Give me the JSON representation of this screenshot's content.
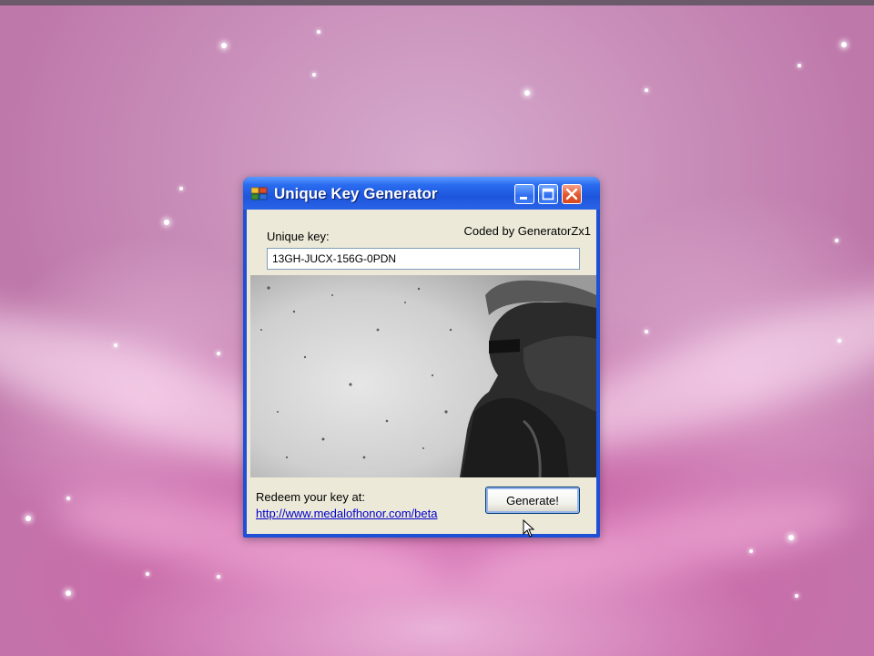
{
  "window": {
    "title": "Unique Key Generator",
    "coded_by": "Coded by GeneratorZx1",
    "key_label": "Unique key:",
    "key_value": "13GH-JUCX-156G-0PDN",
    "redeem_label": "Redeem your key at:",
    "redeem_link": "http://www.medalofhonor.com/beta",
    "generate_label": "Generate!"
  },
  "icons": {
    "app": "app-icon",
    "minimize": "minimize-icon",
    "maximize": "maximize-icon",
    "close": "close-icon",
    "cursor": "mouse-pointer-icon"
  },
  "colors": {
    "titlebar": "#2a63e6",
    "close_button": "#e2552f",
    "link": "#0000cc",
    "client_bg": "#ece9d8"
  }
}
